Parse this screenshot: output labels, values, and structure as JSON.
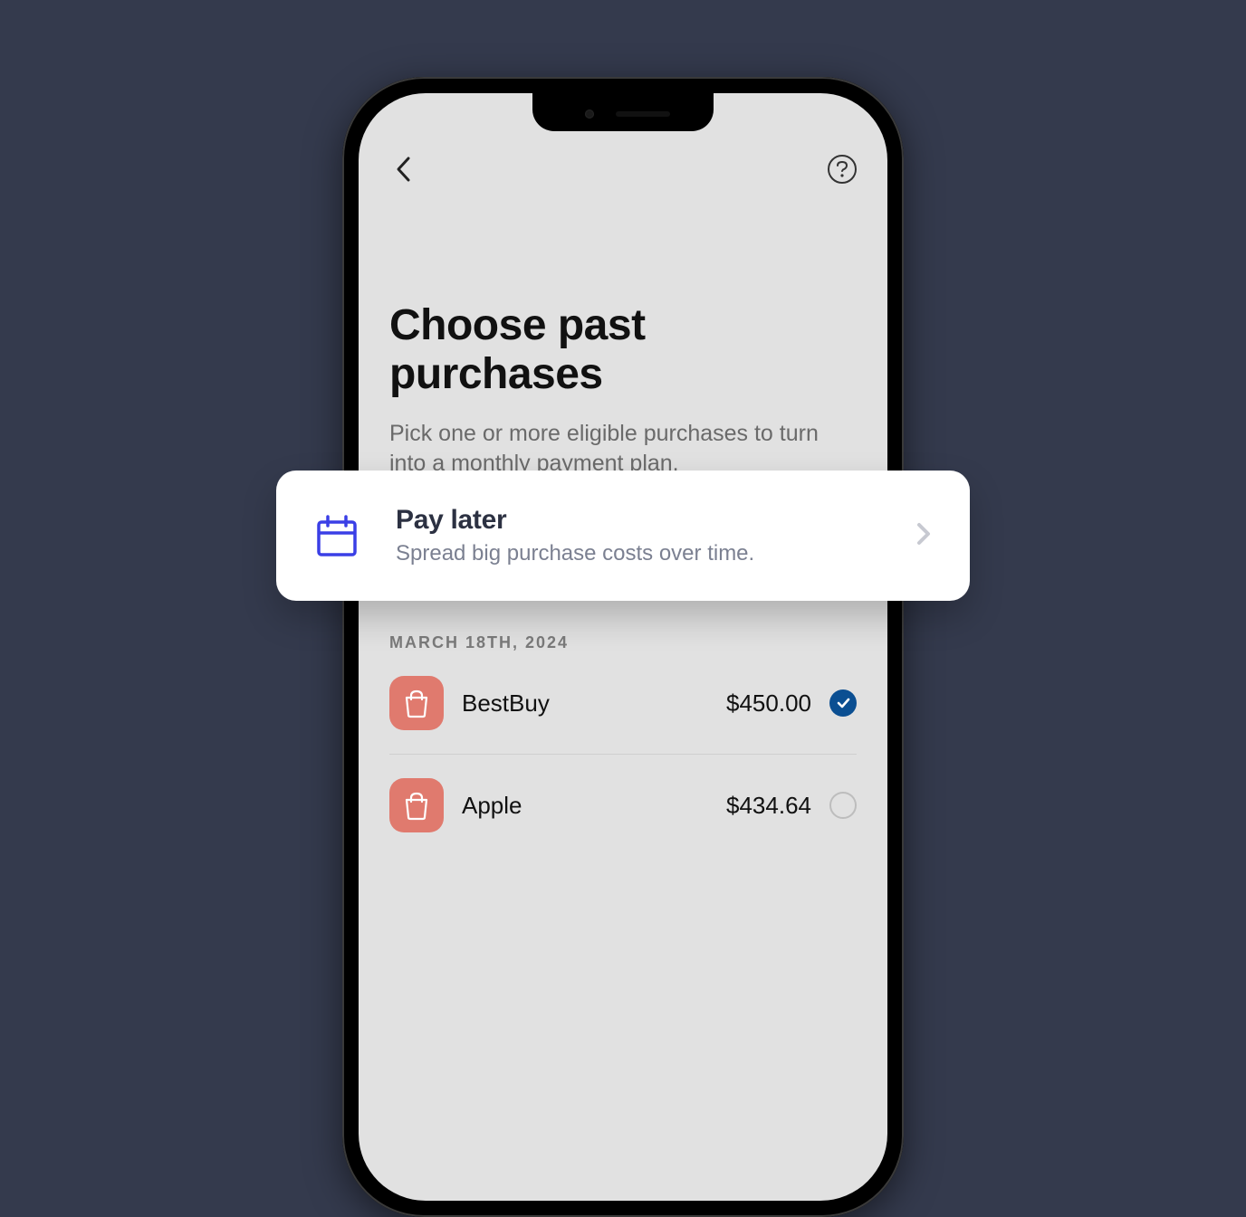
{
  "header": {
    "title": "Choose past purchases",
    "subtitle": "Pick one or more eligible purchases to turn into a monthly payment plan."
  },
  "overlay": {
    "title": "Pay later",
    "subtitle": "Spread big purchase costs over time."
  },
  "purchases": {
    "date_label": "MARCH 18TH, 2024",
    "items": [
      {
        "merchant": "BestBuy",
        "amount": "$450.00",
        "selected": true
      },
      {
        "merchant": "Apple",
        "amount": "$434.64",
        "selected": false
      }
    ]
  },
  "icons": {
    "back": "back-icon",
    "help": "help-icon",
    "calendar": "calendar-icon",
    "chevron": "chevron-right-icon",
    "shopping_bag": "shopping-bag-icon",
    "check": "check-icon"
  },
  "colors": {
    "accent": "#3a3fe6",
    "bag": "#e07a6e",
    "check": "#0b4f92"
  }
}
